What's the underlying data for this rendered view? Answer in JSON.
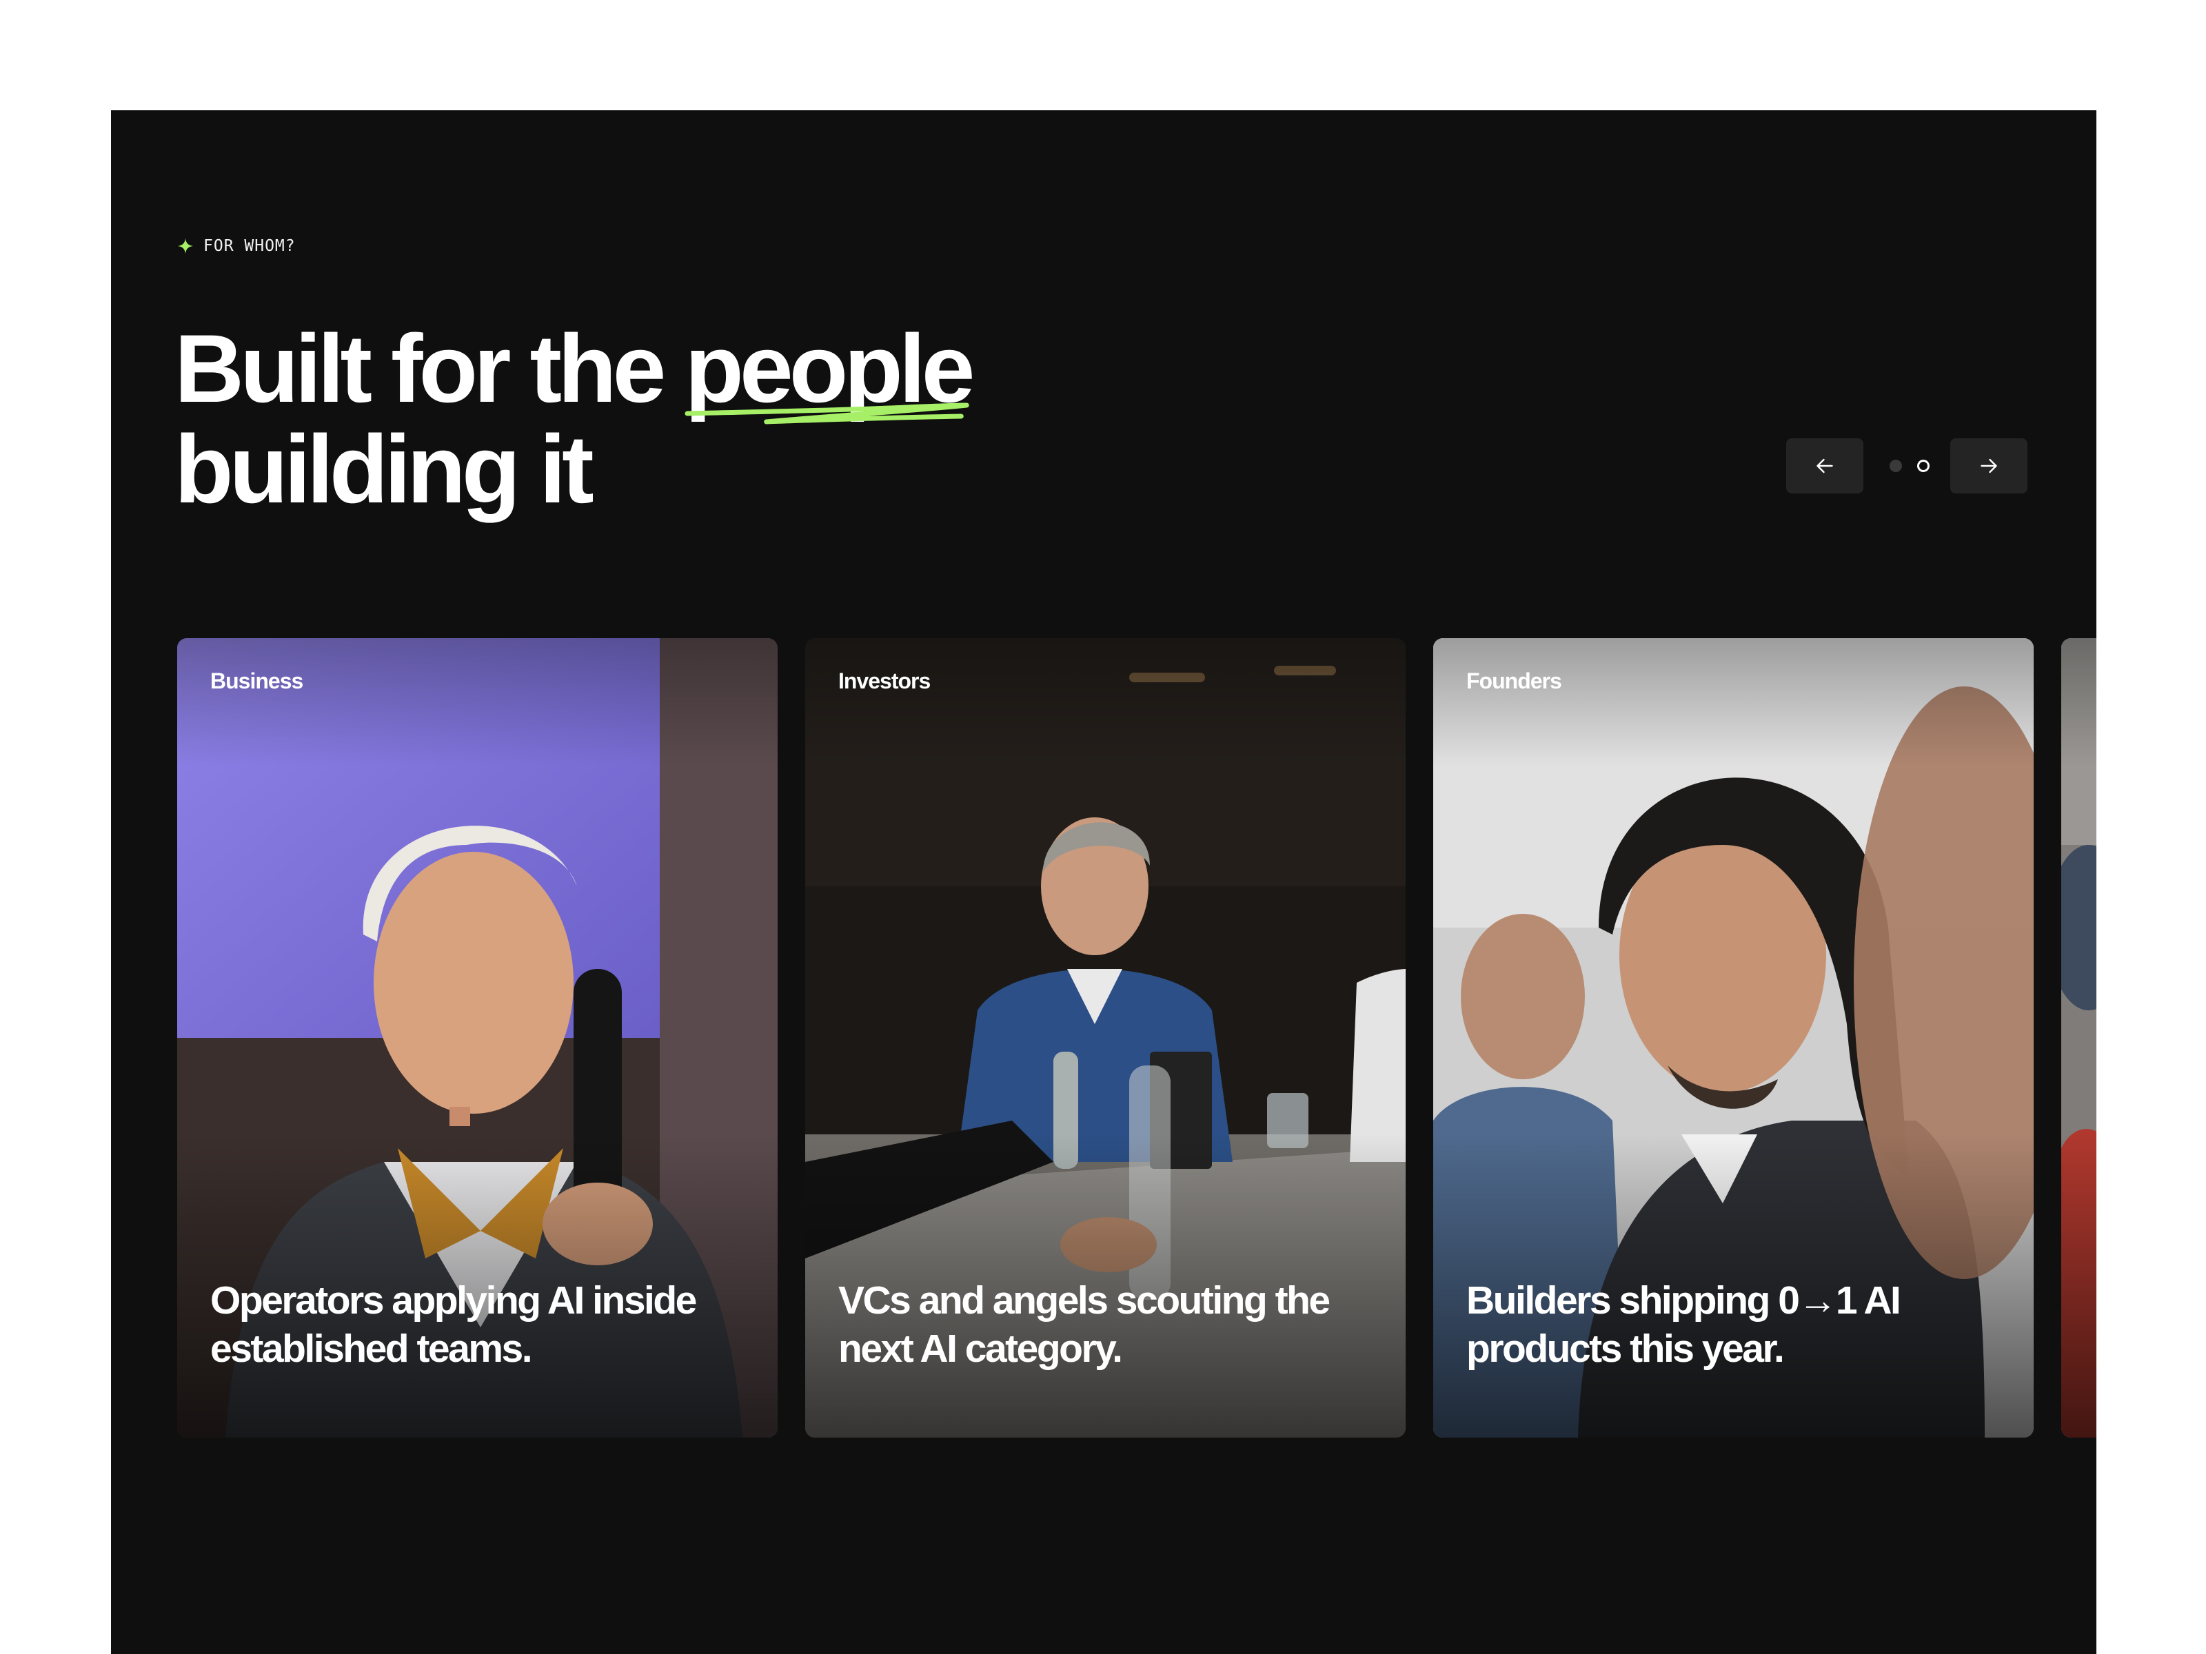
{
  "section": {
    "eyebrow": "FOR WHOM?",
    "headline": {
      "before": "Built for the ",
      "highlight": "people",
      "line2": "building it"
    },
    "accent_color": "#a6ef67"
  },
  "carousel": {
    "prev_icon": "arrow-left-icon",
    "next_icon": "arrow-right-icon",
    "pagination": {
      "pages": 2,
      "current": 2
    }
  },
  "cards": [
    {
      "tag": "Business",
      "caption": "Operators applying AI inside established teams."
    },
    {
      "tag": "Investors",
      "caption": "VCs and angels scouting the next AI category."
    },
    {
      "tag": "Founders",
      "caption": "Builders shipping 0→1 AI products this year."
    },
    {
      "tag": "",
      "caption": ""
    }
  ]
}
